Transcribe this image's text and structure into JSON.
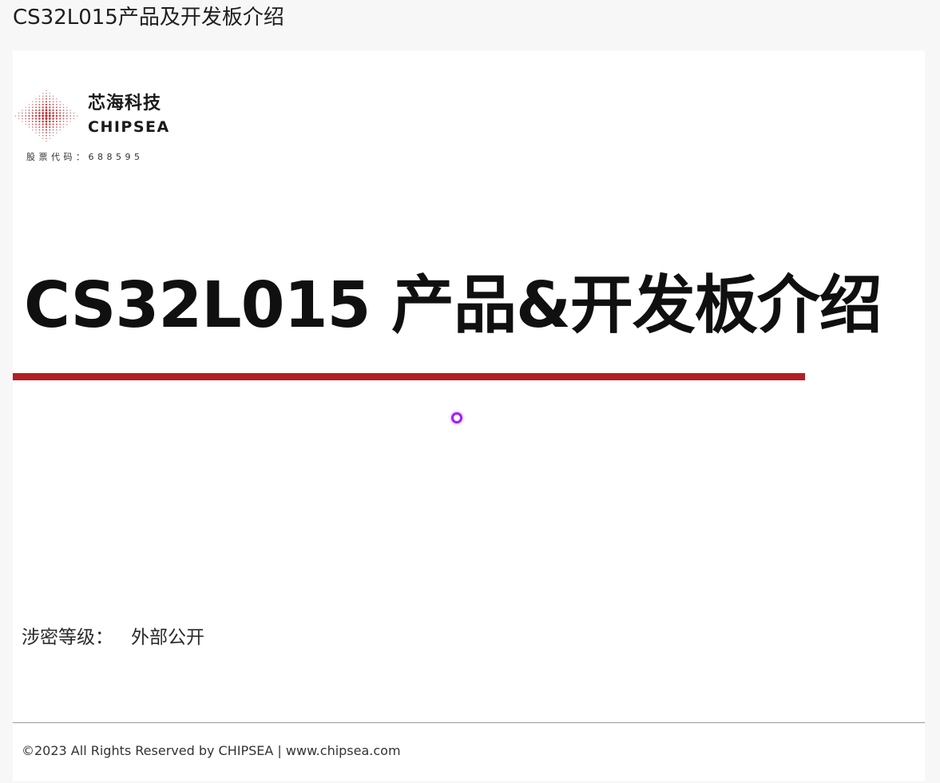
{
  "page": {
    "heading": "CS32L015产品及开发板介绍"
  },
  "slide": {
    "logo": {
      "icon": "chipsea-logo-icon",
      "brand_cn": "芯海科技",
      "brand_en": "CHIPSEA",
      "stock_code": "股票代码：688595",
      "color": "#b21f24"
    },
    "title": "CS32L015 产品&开发板介绍",
    "accent_color": "#b21f24",
    "pointer_color": "#a020f0",
    "classification_label": "涉密等级：",
    "classification_value": "外部公开",
    "footer": "©2023 All Rights Reserved by CHIPSEA | www.chipsea.com"
  }
}
